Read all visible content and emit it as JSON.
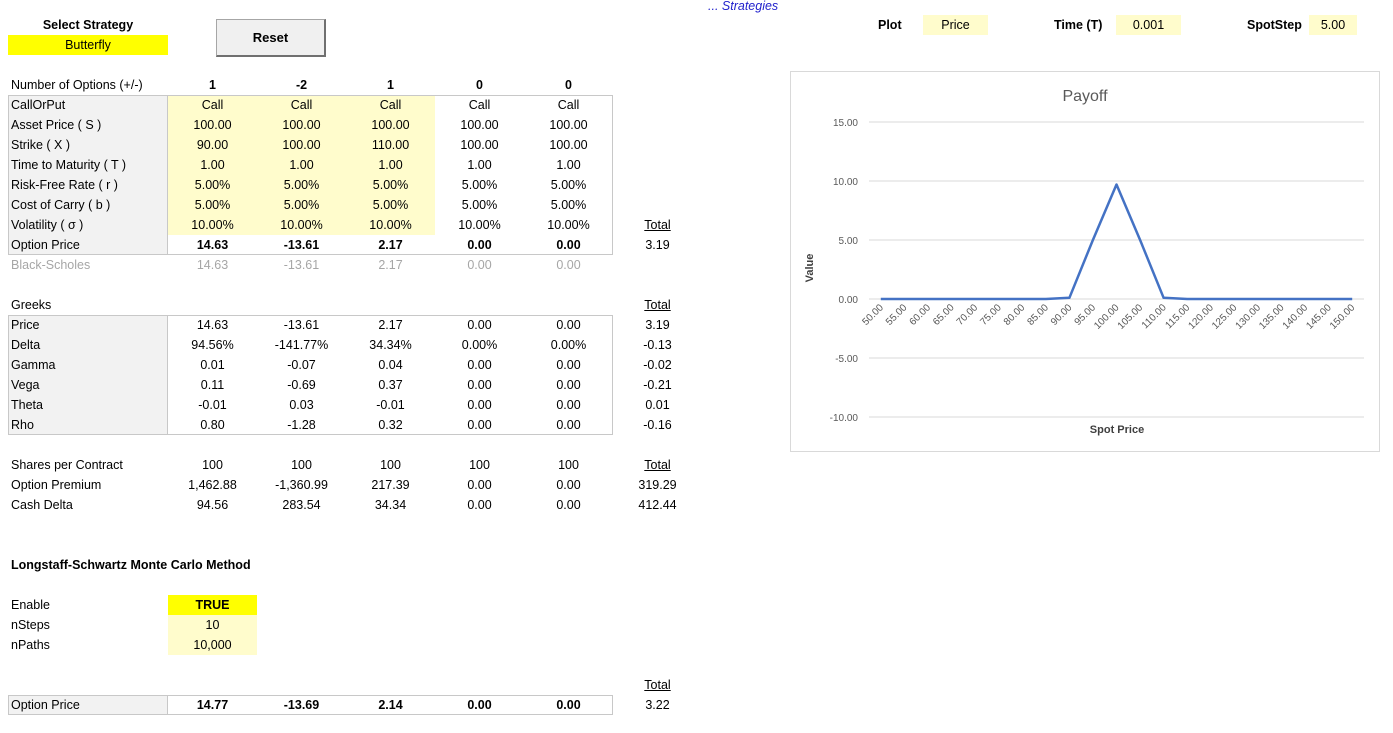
{
  "strategy": {
    "label": "Select Strategy",
    "value": "Butterfly"
  },
  "reset_label": "Reset",
  "strategies_link": "... Strategies",
  "controls": {
    "plot_label": "Plot",
    "plot_value": "Price",
    "time_label": "Time (T)",
    "time_value": "0.001",
    "spotstep_label": "SpotStep",
    "spotstep_value": "5.00"
  },
  "options": {
    "row_labels": [
      "Number of Options (+/-)",
      "CallOrPut",
      "Asset Price ( S )",
      "Strike ( X )",
      "Time to Maturity ( T )",
      "Risk-Free Rate ( r )",
      "Cost of Carry ( b )",
      "Volatility ( σ )",
      "Option Price",
      "Black-Scholes"
    ],
    "number": [
      "1",
      "-2",
      "1",
      "0",
      "0"
    ],
    "callput": [
      "Call",
      "Call",
      "Call",
      "Call",
      "Call"
    ],
    "asset": [
      "100.00",
      "100.00",
      "100.00",
      "100.00",
      "100.00"
    ],
    "strike": [
      "90.00",
      "100.00",
      "110.00",
      "100.00",
      "100.00"
    ],
    "time": [
      "1.00",
      "1.00",
      "1.00",
      "1.00",
      "1.00"
    ],
    "rate": [
      "5.00%",
      "5.00%",
      "5.00%",
      "5.00%",
      "5.00%"
    ],
    "carry": [
      "5.00%",
      "5.00%",
      "5.00%",
      "5.00%",
      "5.00%"
    ],
    "vol": [
      "10.00%",
      "10.00%",
      "10.00%",
      "10.00%",
      "10.00%"
    ],
    "price": [
      "14.63",
      "-13.61",
      "2.17",
      "0.00",
      "0.00"
    ],
    "bs": [
      "14.63",
      "-13.61",
      "2.17",
      "0.00",
      "0.00"
    ],
    "total_label": "Total",
    "total_price": "3.19"
  },
  "greeks": {
    "title": "Greeks",
    "total_label": "Total",
    "row_labels": [
      "Price",
      "Delta",
      "Gamma",
      "Vega",
      "Theta",
      "Rho"
    ],
    "rows": [
      [
        "14.63",
        "-13.61",
        "2.17",
        "0.00",
        "0.00",
        "3.19"
      ],
      [
        "94.56%",
        "-141.77%",
        "34.34%",
        "0.00%",
        "0.00%",
        "-0.13"
      ],
      [
        "0.01",
        "-0.07",
        "0.04",
        "0.00",
        "0.00",
        "-0.02"
      ],
      [
        "0.11",
        "-0.69",
        "0.37",
        "0.00",
        "0.00",
        "-0.21"
      ],
      [
        "-0.01",
        "0.03",
        "-0.01",
        "0.00",
        "0.00",
        "0.01"
      ],
      [
        "0.80",
        "-1.28",
        "0.32",
        "0.00",
        "0.00",
        "-0.16"
      ]
    ]
  },
  "contracts": {
    "total_label": "Total",
    "row_labels": [
      "Shares per Contract",
      "Option Premium",
      "Cash Delta"
    ],
    "rows": [
      [
        "100",
        "100",
        "100",
        "100",
        "100",
        ""
      ],
      [
        "1,462.88",
        "-1,360.99",
        "217.39",
        "0.00",
        "0.00",
        "319.29"
      ],
      [
        "94.56",
        "283.54",
        "34.34",
        "0.00",
        "0.00",
        "412.44"
      ]
    ]
  },
  "mc": {
    "title": "Longstaff-Schwartz Monte Carlo Method",
    "enable_label": "Enable",
    "enable_value": "TRUE",
    "nsteps_label": "nSteps",
    "nsteps_value": "10",
    "npaths_label": "nPaths",
    "npaths_value": "10,000",
    "total_label": "Total",
    "price_label": "Option Price",
    "prices": [
      "14.77",
      "-13.69",
      "2.14",
      "0.00",
      "0.00"
    ],
    "total": "3.22"
  },
  "colors": {
    "highlight": "#ffff00",
    "input_fill": "#fffccc",
    "label_fill": "#f2f2f2",
    "line": "#4472c4"
  },
  "chart_data": {
    "type": "line",
    "title": "Payoff",
    "xlabel": "Spot Price",
    "ylabel": "Value",
    "ylim": [
      -10,
      15
    ],
    "yticks": [
      "15.00",
      "10.00",
      "5.00",
      "0.00",
      "-5.00",
      "-10.00"
    ],
    "x": [
      "50.00",
      "55.00",
      "60.00",
      "65.00",
      "70.00",
      "75.00",
      "80.00",
      "85.00",
      "90.00",
      "95.00",
      "100.00",
      "105.00",
      "110.00",
      "115.00",
      "120.00",
      "125.00",
      "130.00",
      "135.00",
      "140.00",
      "145.00",
      "150.00"
    ],
    "series": [
      {
        "values": [
          0,
          0,
          0,
          0,
          0,
          0,
          0,
          0,
          0.1,
          5.0,
          9.7,
          5.0,
          0.1,
          0,
          0,
          0,
          0,
          0,
          0,
          0,
          0
        ]
      }
    ],
    "grid": true
  }
}
